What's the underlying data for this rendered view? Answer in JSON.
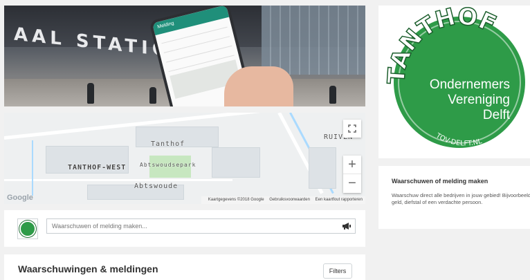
{
  "hero": {
    "station_text": "AAL STATION",
    "phone_header": "Melding"
  },
  "map": {
    "labels": {
      "tanthof": "Tanthof",
      "tanthof_west": "TANTHOF-WEST",
      "abtswoudsepark": "Abtswoudsepark",
      "abtswoude": "Abtswoude",
      "ruiven": "RUIVEN"
    },
    "google": "Google",
    "attribution": [
      "Kaartgegevens ©2018 Google",
      "Gebruiksvoorwaarden",
      "Een kaartfout rapporteren"
    ],
    "zoom_in": "+",
    "zoom_out": "−",
    "fullscreen_icon": "fullscreen-icon"
  },
  "post": {
    "placeholder": "Waarschuwen of melding maken...",
    "icon": "megaphone-icon"
  },
  "feed": {
    "title": "Waarschuwingen & meldingen",
    "filters_label": "Filters"
  },
  "logo": {
    "top_text": "TANTHOF",
    "line1": "Ondernemers",
    "line2": "Vereniging",
    "line3": "Delft",
    "url": "TOV-DELFT.NL",
    "colors": {
      "green": "#2e9b48",
      "dark": "#1b5e2c",
      "white": "#ffffff"
    }
  },
  "info": {
    "heading": "Waarschuwen of melding maken",
    "text": "Waarschuw direct alle bedrijven in jouw gebied! Bijvoorbeeld voor vals geld, diefstal of een verdachte persoon."
  }
}
